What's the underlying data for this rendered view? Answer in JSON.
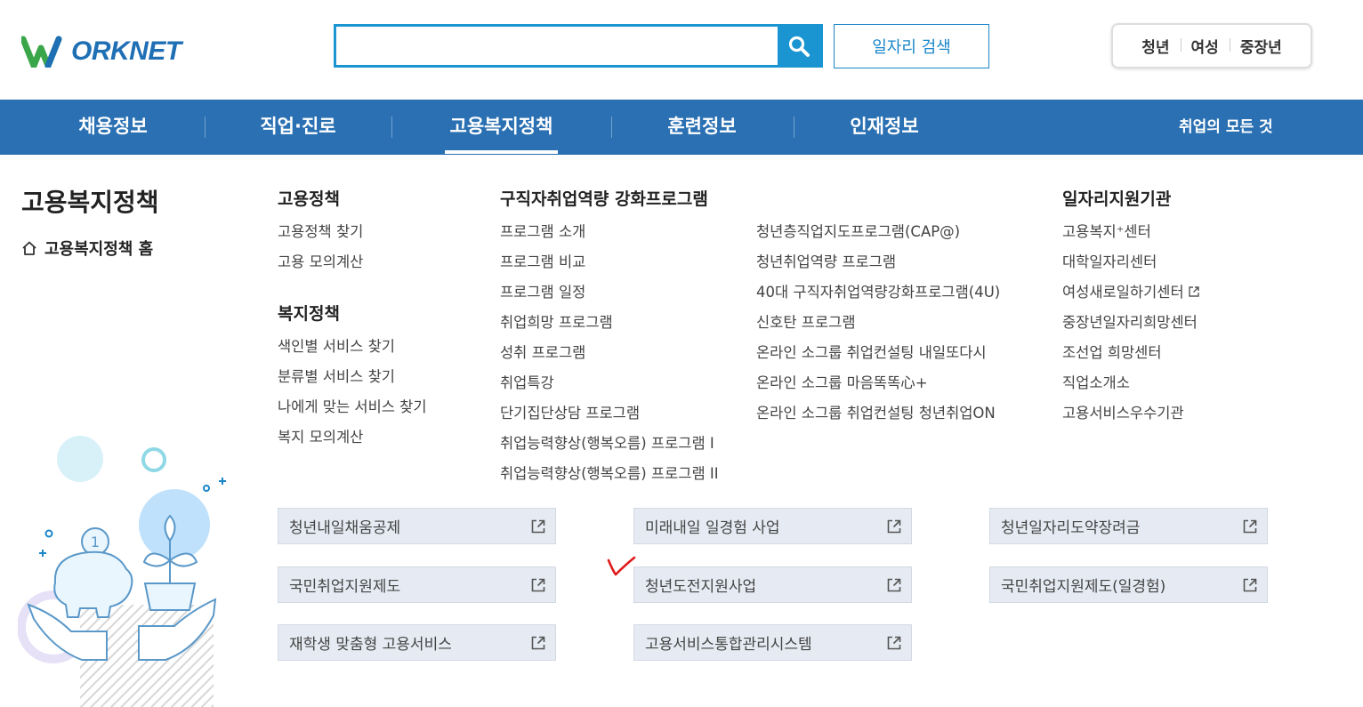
{
  "header": {
    "logo_text": "ORKNET",
    "search": {
      "value": "",
      "placeholder": ""
    },
    "job_search_label": "일자리 검색",
    "targets": [
      "청년",
      "여성",
      "중장년"
    ]
  },
  "gnb": {
    "items": [
      "채용정보",
      "직업·진로",
      "고용복지정책",
      "훈련정보",
      "인재정보"
    ],
    "active": "고용복지정책",
    "right_label": "취업의 모든 것"
  },
  "side": {
    "title": "고용복지정책",
    "home_label": "고용복지정책 홈"
  },
  "menu": {
    "employment_policy": {
      "title": "고용정책",
      "links": [
        "고용정책 찾기",
        "고용 모의계산"
      ]
    },
    "welfare_policy": {
      "title": "복지정책",
      "links": [
        "색인별 서비스 찾기",
        "분류별 서비스 찾기",
        "나에게 맞는 서비스 찾기",
        "복지 모의계산"
      ]
    },
    "programs": {
      "title": "구직자취업역량 강화프로그램",
      "left_links": [
        "프로그램 소개",
        "프로그램 비교",
        "프로그램 일정",
        "취업희망 프로그램",
        "성취 프로그램",
        "취업특강",
        "단기집단상담 프로그램",
        "취업능력향상(행복오름) 프로그램 I",
        "취업능력향상(행복오름) 프로그램 II"
      ],
      "right_links": [
        "청년층직업지도프로그램(CAP@)",
        "청년취업역량 프로그램",
        "40대 구직자취업역량강화프로그램(4U)",
        "신호탄 프로그램",
        "온라인 소그룹 취업컨설팅 내일또다시",
        "온라인 소그룹 마음똑똑心+",
        "온라인 소그룹 취업컨설팅 청년취업ON"
      ]
    },
    "agencies": {
      "title": "일자리지원기관",
      "links": [
        "고용복지⁺센터",
        "대학일자리센터",
        "여성새로일하기센터",
        "중장년일자리희망센터",
        "조선업 희망센터",
        "직업소개소",
        "고용서비스우수기관"
      ]
    }
  },
  "quick_links": [
    "청년내일채움공제",
    "미래내일 일경험 사업",
    "청년일자리도약장려금",
    "국민취업지원제도",
    "청년도전지원사업",
    "국민취업지원제도(일경험)",
    "재학생 맞춤형 고용서비스",
    "고용서비스통합관리시스템"
  ],
  "colors": {
    "nav_bg": "#2a70b3",
    "search_accent": "#1a95d2",
    "quick_box_bg": "#e6ebf3",
    "check_mark": "#e01a1a"
  }
}
